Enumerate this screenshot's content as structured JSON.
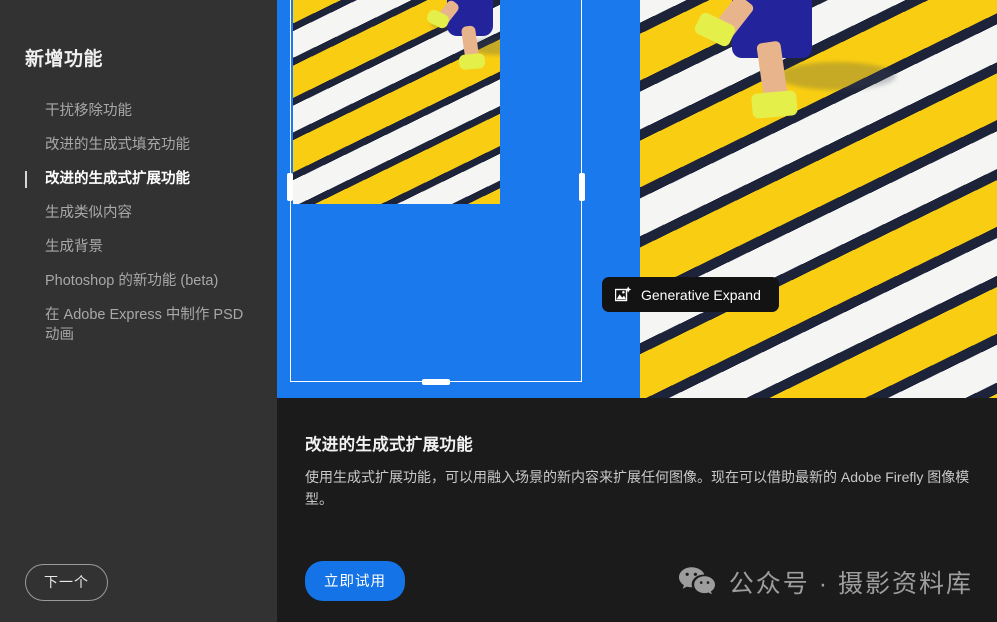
{
  "sidebar": {
    "title": "新增功能",
    "items": [
      {
        "label": "干扰移除功能",
        "active": false
      },
      {
        "label": "改进的生成式填充功能",
        "active": false
      },
      {
        "label": "改进的生成式扩展功能",
        "active": true
      },
      {
        "label": "生成类似内容",
        "active": false
      },
      {
        "label": "生成背景",
        "active": false
      },
      {
        "label": "Photoshop 的新功能 (beta)",
        "active": false
      },
      {
        "label": "在 Adobe Express 中制作 PSD 动画",
        "active": false
      }
    ],
    "next_label": "下一个"
  },
  "media": {
    "pill_label": "Generative Expand",
    "pill_icon": "generative-expand-icon"
  },
  "description": {
    "title": "改进的生成式扩展功能",
    "body": "使用生成式扩展功能，可以用融入场景的新内容来扩展任何图像。现在可以借助最新的 Adobe Firefly 图像模型。",
    "try_label": "立即试用"
  },
  "watermark": {
    "icon": "wechat-icon",
    "text": "公众号 · 摄影资料库"
  },
  "colors": {
    "sidebar_bg": "#323232",
    "panel_bg": "#1b1b1b",
    "accent_blue": "#1473e6",
    "canvas_blue": "#1a7aed",
    "pill_bg": "#131313",
    "stripe_yellow": "#f9ce12",
    "stripe_dark": "#1d2339",
    "stripe_white": "#f5f5f3"
  }
}
